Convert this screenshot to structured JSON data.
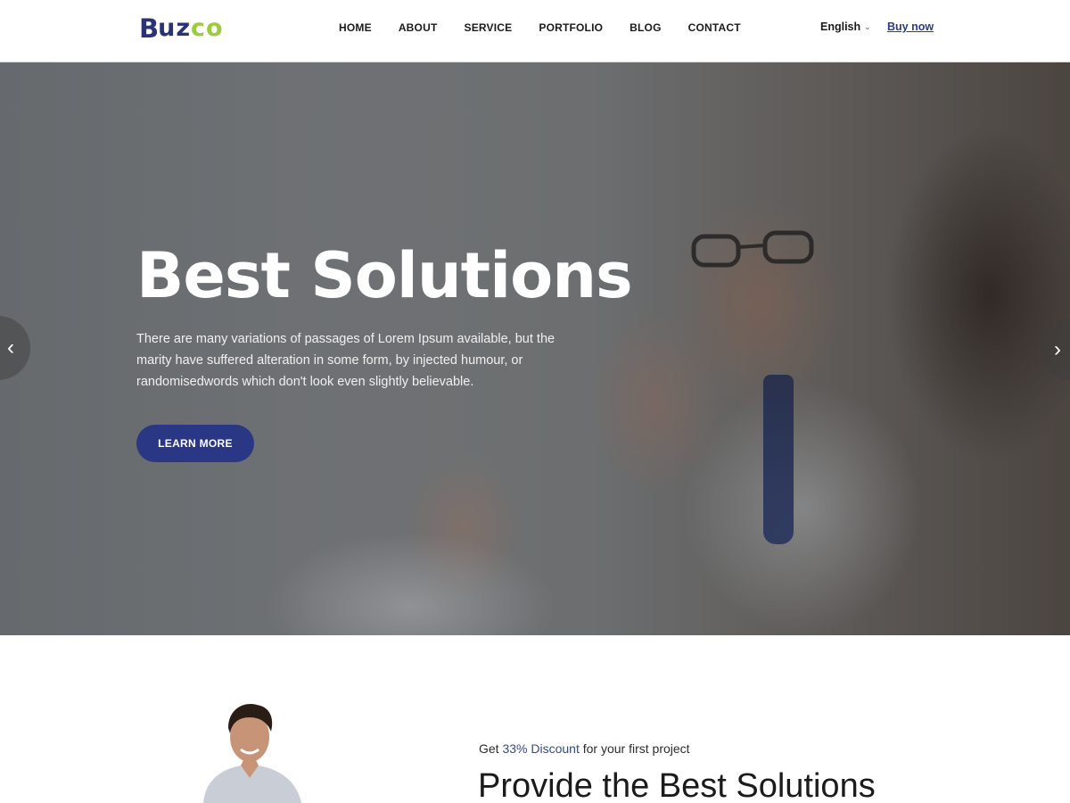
{
  "header": {
    "logo": {
      "part1": "B",
      "part2": "uz",
      "part3": "co"
    },
    "nav": [
      {
        "label": "HOME"
      },
      {
        "label": "ABOUT"
      },
      {
        "label": "SERVICE"
      },
      {
        "label": "PORTFOLIO"
      },
      {
        "label": "BLOG"
      },
      {
        "label": "CONTACT"
      }
    ],
    "language": {
      "label": "English",
      "icon": "chevron-down-icon"
    },
    "buy_now": "Buy now"
  },
  "hero": {
    "title": "Best Solutions",
    "text": "There are many variations of passages of Lorem Ipsum available, but the marity have suffered alteration in some form, by injected humour, or randomisedwords which don't look even slightly believable.",
    "cta": "LEARN MORE",
    "prev_icon": "‹",
    "next_icon": "›"
  },
  "about": {
    "promo_prefix": "Get ",
    "promo_highlight": "33% Discount",
    "promo_suffix": " for your first project",
    "title": "Provide the Best Solutions"
  },
  "colors": {
    "brand_blue": "#2a3785",
    "brand_green": "#9ccb3b",
    "link_blue": "#2a3a8c"
  }
}
